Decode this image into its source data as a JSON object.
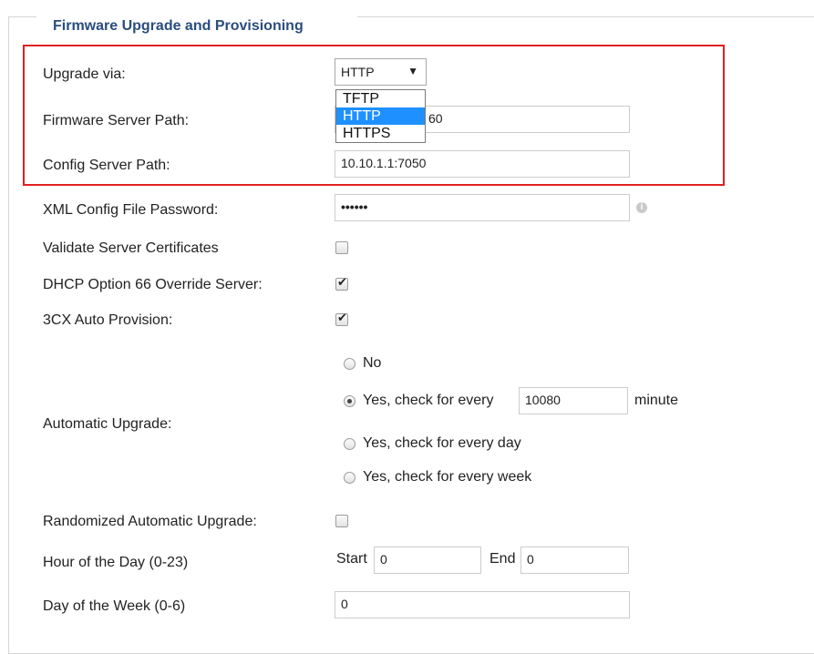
{
  "section": {
    "title": "Firmware Upgrade and Provisioning"
  },
  "upgrade_via": {
    "label": "Upgrade via:",
    "selected": "HTTP",
    "options": [
      "TFTP",
      "HTTP",
      "HTTPS"
    ],
    "highlighted_option": "HTTP"
  },
  "firmware_server_path": {
    "label": "Firmware Server Path:",
    "visible_value": "60"
  },
  "config_server_path": {
    "label": "Config Server Path:",
    "value": "10.10.1.1:7050"
  },
  "xml_password": {
    "label": "XML Config File Password:",
    "value": "••••••"
  },
  "validate_certs": {
    "label": "Validate Server Certificates",
    "checked": false
  },
  "dhcp66": {
    "label": "DHCP Option 66 Override Server:",
    "checked": true
  },
  "auto_provision": {
    "label": "3CX Auto Provision:",
    "checked": true
  },
  "automatic_upgrade": {
    "label": "Automatic Upgrade:",
    "options": {
      "no": "No",
      "every_minutes": "Yes, check for every",
      "every_day": "Yes, check for every day",
      "every_week": "Yes, check for every week"
    },
    "selected": "every_minutes",
    "minutes_value": "10080",
    "minutes_unit": "minute"
  },
  "randomized": {
    "label": "Randomized Automatic Upgrade:",
    "checked": false
  },
  "hour_of_day": {
    "label": "Hour of the Day (0-23)",
    "start_label": "Start",
    "start_value": "0",
    "end_label": "End",
    "end_value": "0"
  },
  "day_of_week": {
    "label": "Day of the Week (0-6)",
    "value": "0"
  },
  "colors": {
    "legend": "#2a4d7e",
    "highlight_border": "#e02020",
    "selected_option": "#1e90ff"
  },
  "icons": {
    "info": "info-icon",
    "dropdown_arrow": "caret-down-icon"
  }
}
